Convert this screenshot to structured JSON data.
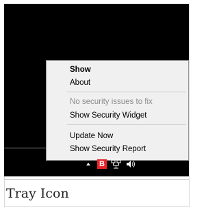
{
  "context_menu": {
    "items": [
      {
        "label": "Show",
        "bold": true
      },
      {
        "label": "About"
      },
      {
        "label": "No security issues to fix",
        "disabled": true
      },
      {
        "label": "Show Security Widget"
      },
      {
        "label": "Update Now"
      },
      {
        "label": "Show Security Report"
      }
    ]
  },
  "taskbar": {
    "icons": [
      "show-hidden-icons-arrow",
      "security-app-icon",
      "network-icon",
      "volume-icon"
    ],
    "brand_icon_letter": "B",
    "brand_color": "#e8262a"
  },
  "caption": "Tray Icon"
}
